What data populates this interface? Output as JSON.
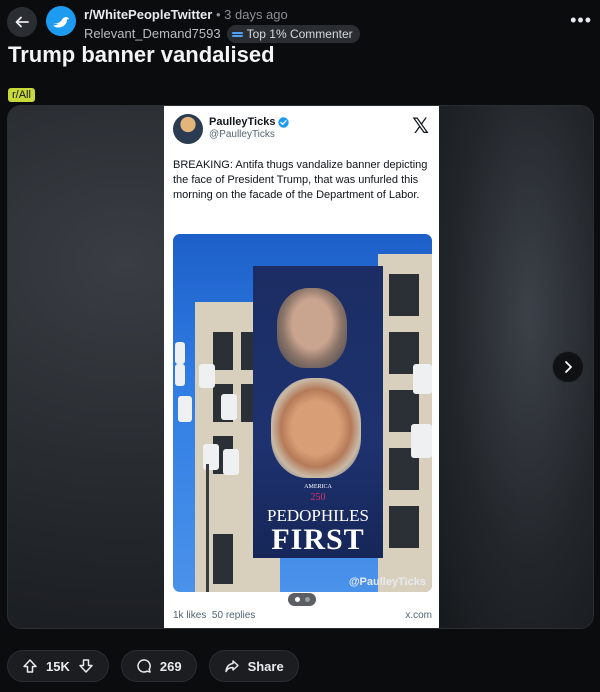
{
  "header": {
    "subreddit": "r/WhitePeopleTwitter",
    "separator": "•",
    "time": "3 days ago",
    "username": "Relevant_Demand7593",
    "badge": "Top 1% Commenter"
  },
  "post": {
    "title": "Trump banner vandalised",
    "flair": "r/All"
  },
  "tweet": {
    "name": "PaulleyTicks",
    "handle": "@PaulleyTicks",
    "text": "BREAKING: Antifa thugs vandalize banner depicting the face of President Trump, that was unfurled this morning on the facade of the Department of Labor.",
    "banner_small": "AMERICA",
    "banner_num": "250",
    "banner_line1": "PEDOPHILES",
    "banner_line2": "FIRST",
    "watermark": "@PaulleyTicks",
    "likes": "1k likes",
    "replies": "50 replies",
    "source": "x.com"
  },
  "actions": {
    "votes": "15K",
    "comments": "269",
    "share": "Share"
  },
  "colors": {
    "background": "#0b0c0e",
    "flair": "#c8d93a",
    "verified": "#1d9bf0"
  },
  "icons": [
    "back-arrow-icon",
    "subreddit-bird-icon",
    "more-icon",
    "chevron-right-icon",
    "upvote-icon",
    "downvote-icon",
    "comment-icon",
    "share-icon",
    "verified-icon",
    "x-logo-icon"
  ]
}
